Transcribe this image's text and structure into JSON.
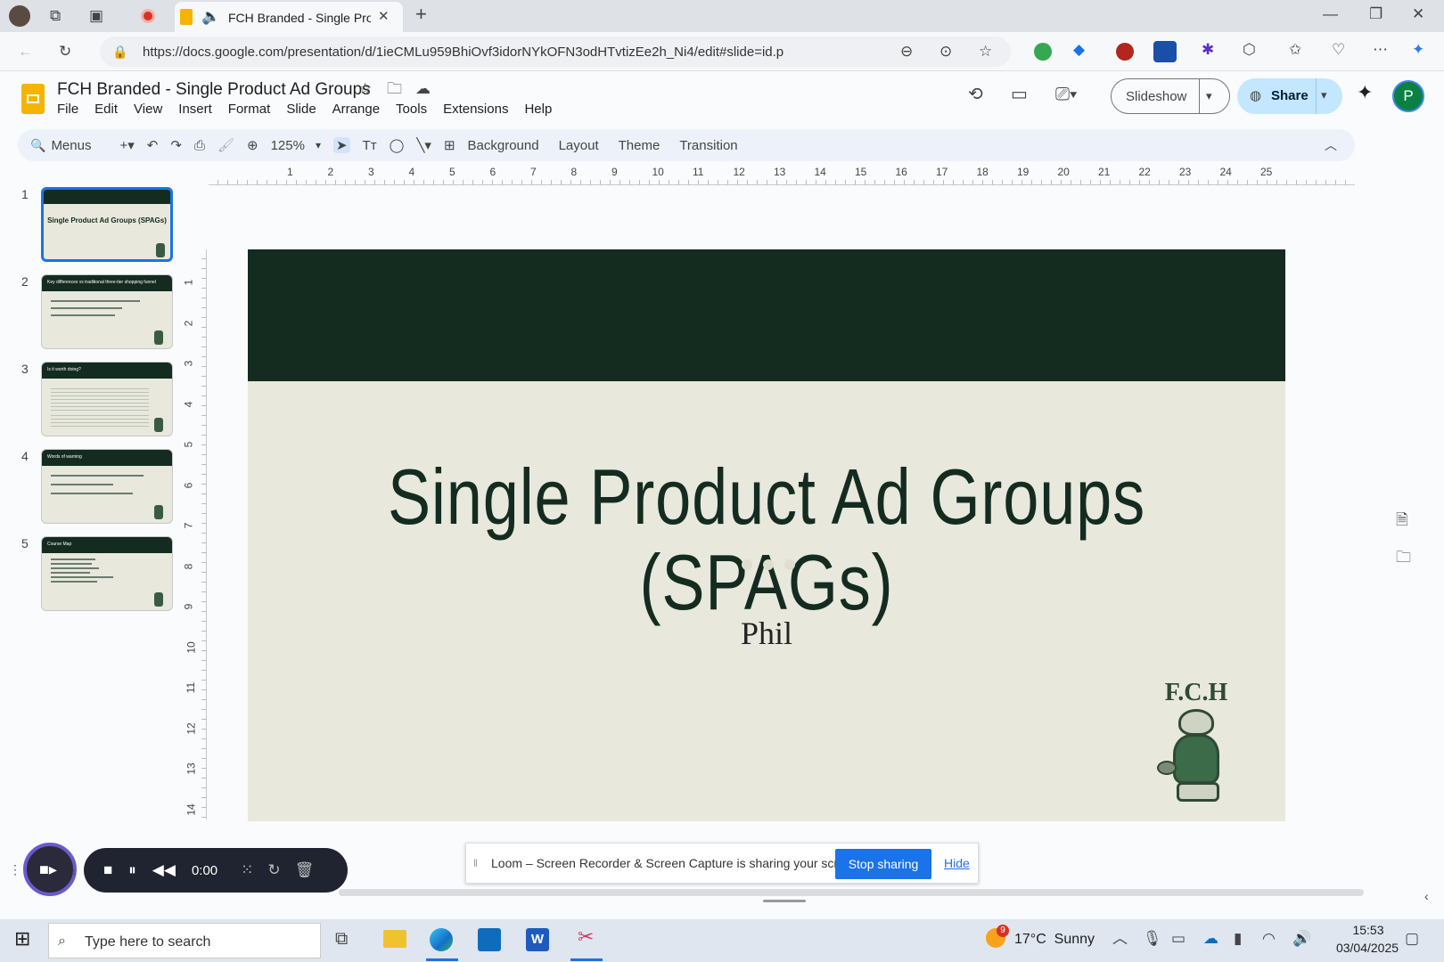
{
  "browser": {
    "tab_title": "FCH Branded - Single Produ",
    "url": "https://docs.google.com/presentation/d/1ieCMLu959BhiOvf3idorNYkOFN3odHTvtizEe2h_Ni4/edit#slide=id.p"
  },
  "doc": {
    "title": "FCH Branded - Single Product Ad Groups",
    "menus": [
      "File",
      "Edit",
      "View",
      "Insert",
      "Format",
      "Slide",
      "Arrange",
      "Tools",
      "Extensions",
      "Help"
    ],
    "slideshow_label": "Slideshow",
    "share_label": "Share",
    "avatar_letter": "P"
  },
  "toolbar": {
    "search_label": "Menus",
    "zoom": "125%",
    "background": "Background",
    "layout": "Layout",
    "theme": "Theme",
    "transition": "Transition"
  },
  "thumbnails": {
    "nums": [
      "1",
      "2",
      "3",
      "4",
      "5"
    ],
    "t1": "Single Product Ad Groups (SPAGs)",
    "t2": "Key differences vs traditional three-tier shopping funnel",
    "t3": "Is it worth doing?",
    "t4": "Words of warning",
    "t5": "Course Map"
  },
  "ruler": {
    "h": [
      "1",
      "2",
      "3",
      "4",
      "5",
      "6",
      "7",
      "8",
      "9",
      "10",
      "11",
      "12",
      "13",
      "14",
      "15",
      "16",
      "17",
      "18",
      "19",
      "20",
      "21",
      "22",
      "23",
      "24",
      "25"
    ],
    "v": [
      "1",
      "2",
      "3",
      "4",
      "5",
      "6",
      "7",
      "8",
      "9",
      "10",
      "11",
      "12",
      "13",
      "14"
    ]
  },
  "slide": {
    "title": "Single Product Ad Groups (SPAGs)",
    "subtitle": "Phil",
    "logo_text": "F.C.H",
    "colors": {
      "header": "#142b20",
      "body": "#e8e8dc",
      "text": "#142b20"
    }
  },
  "loom": {
    "message": "Loom – Screen Recorder & Screen Capture is sharing your screen.",
    "stop": "Stop sharing",
    "hide": "Hide",
    "timer": "0:00"
  },
  "taskbar": {
    "search_placeholder": "Type here to search",
    "weather": "17°C  Sunny",
    "weather_badge": "9",
    "time": "15:53",
    "date": "03/04/2025"
  }
}
